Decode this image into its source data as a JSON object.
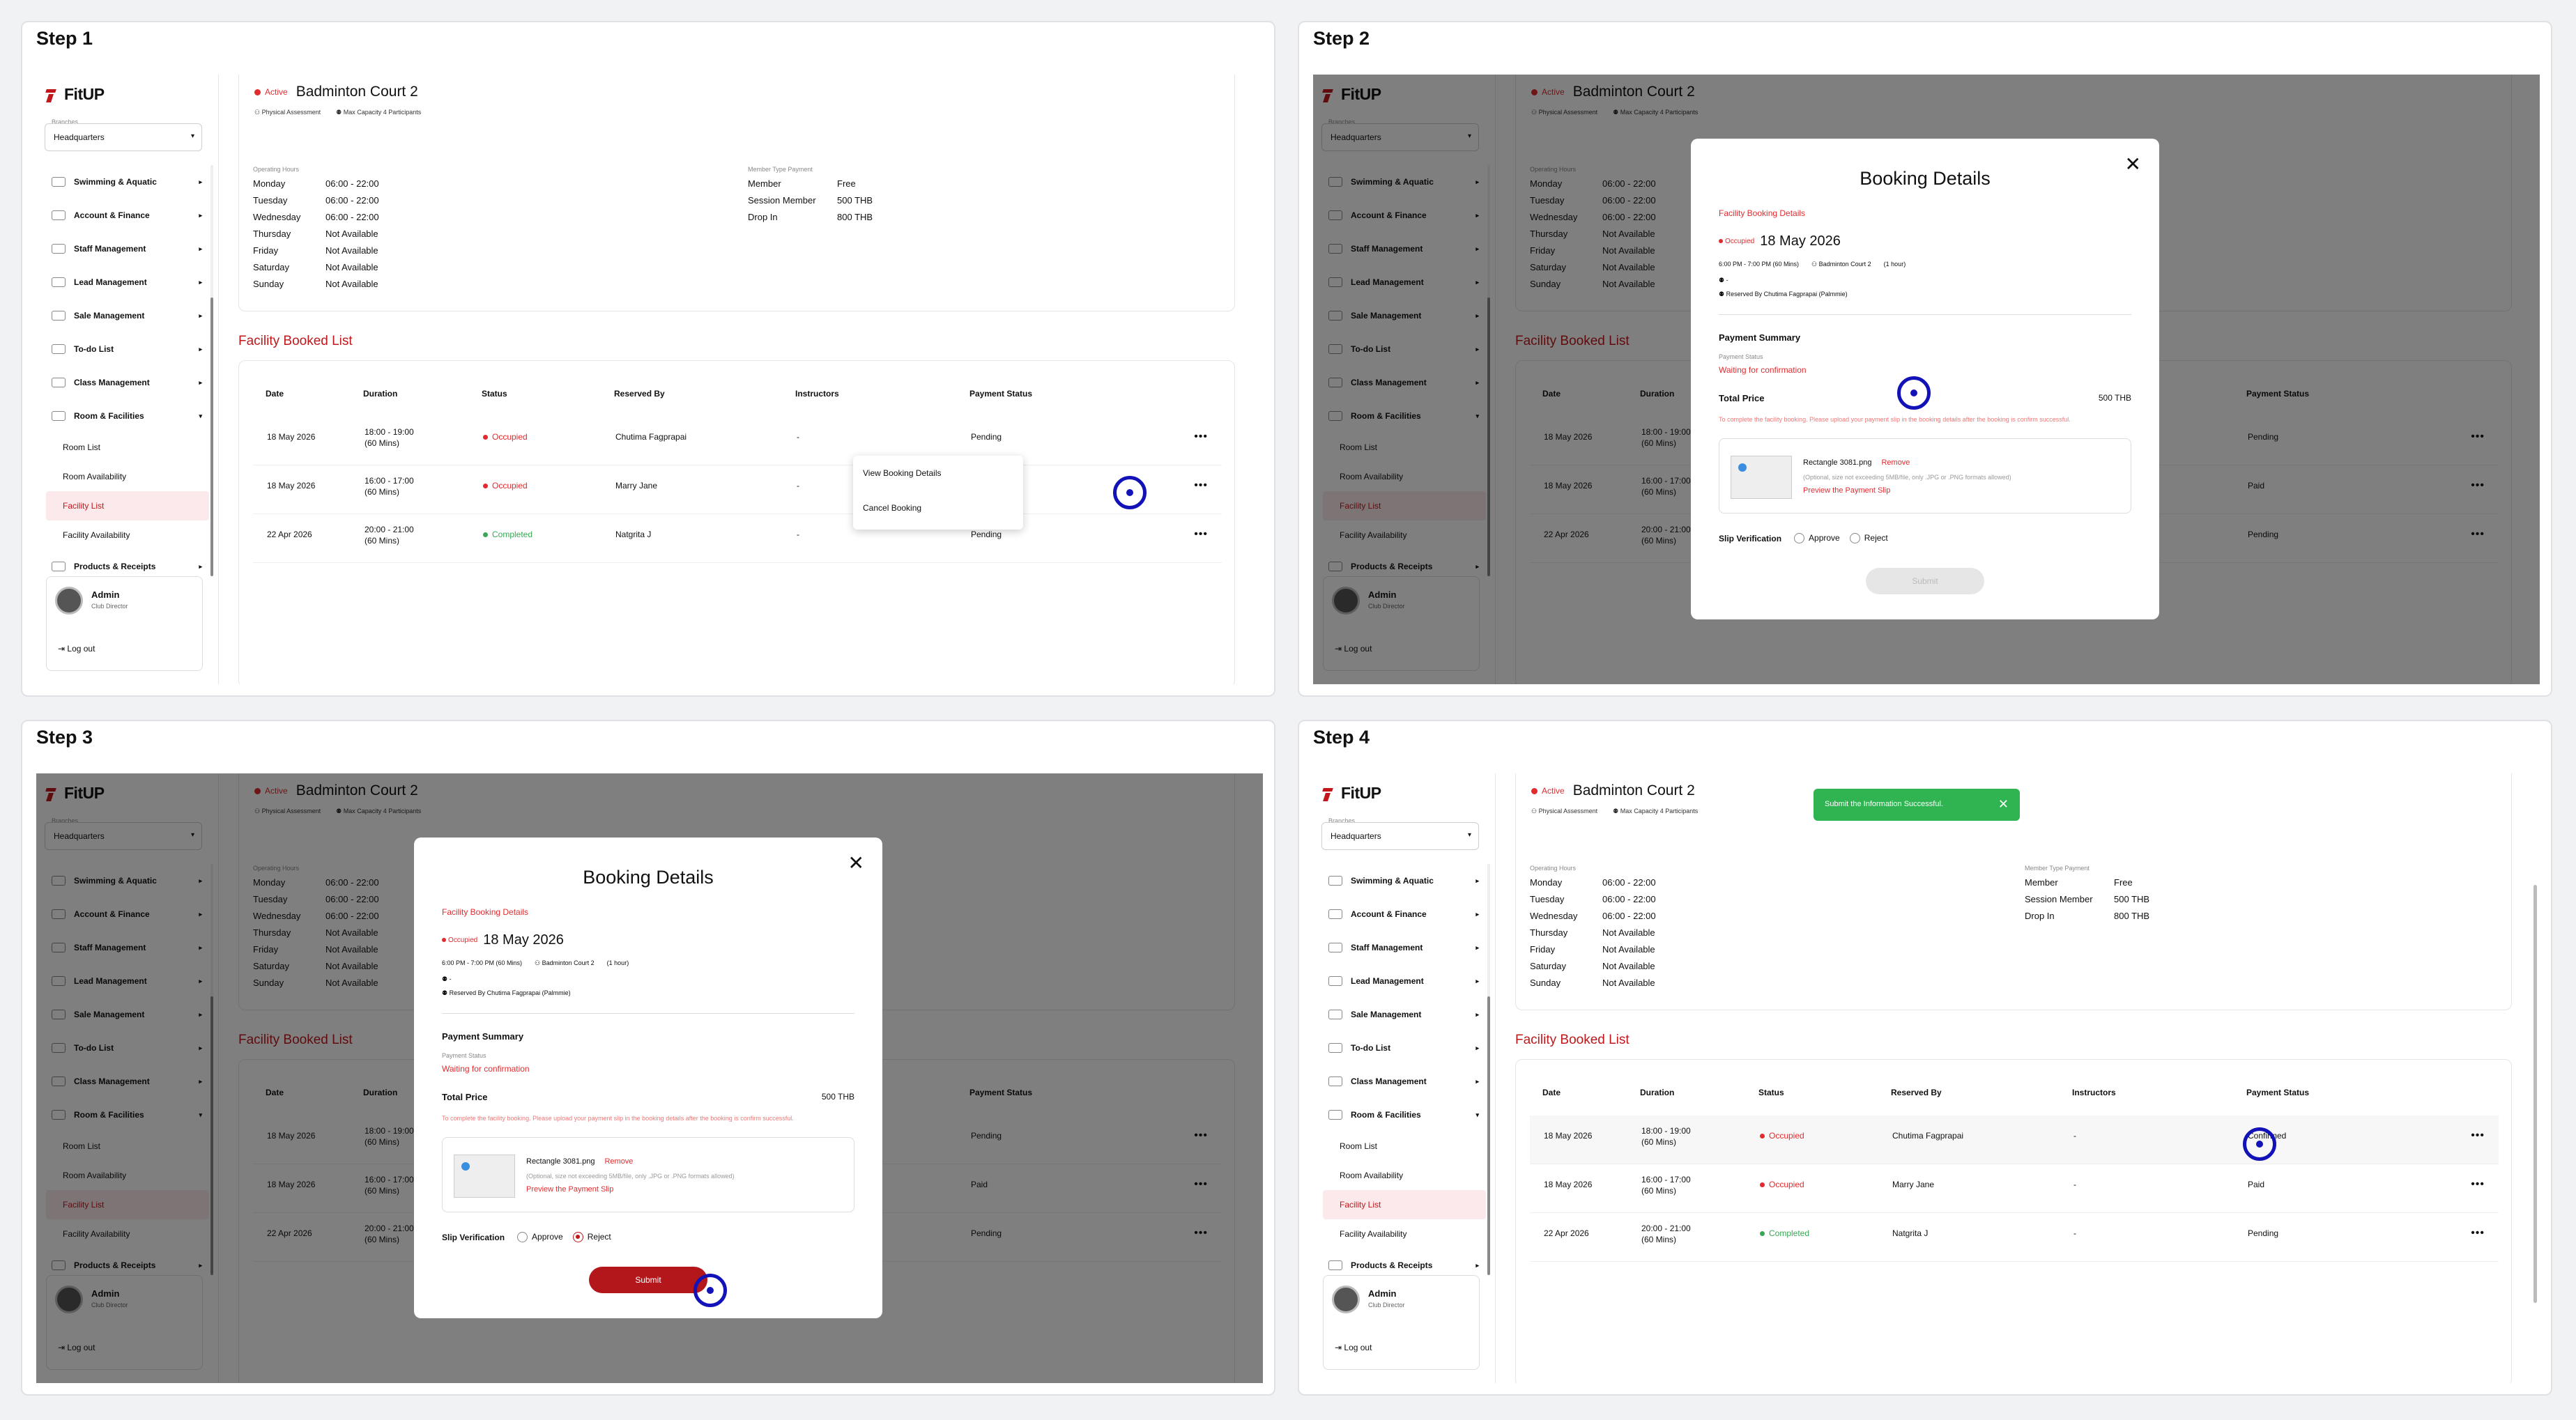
{
  "steps": [
    "Step 1",
    "Step 2",
    "Step 3",
    "Step 4"
  ],
  "app": {
    "logo": "FitUP",
    "branch_label": "Branches",
    "branch": "Headquarters",
    "nav": [
      {
        "label": "Swimming & Aquatic"
      },
      {
        "label": "Account & Finance"
      },
      {
        "label": "Staff Management"
      },
      {
        "label": "Lead Management"
      },
      {
        "label": "Sale Management"
      },
      {
        "label": "To-do List"
      },
      {
        "label": "Class Management"
      },
      {
        "label": "Room & Facilities"
      }
    ],
    "sub_nav": [
      "Room List",
      "Room Availability",
      "Facility List",
      "Facility Availability"
    ],
    "nav_last": "Products & Receipts",
    "user": {
      "name": "Admin",
      "role": "Club Director",
      "logout": "Log out"
    }
  },
  "facility": {
    "status": "Active",
    "name": "Badminton Court 2",
    "type": "Physical Assessment",
    "capacity": "Max Capacity 4 Participants",
    "hours_label": "Operating Hours",
    "hours": [
      {
        "day": "Monday",
        "time": "06:00 - 22:00"
      },
      {
        "day": "Tuesday",
        "time": "06:00 - 22:00"
      },
      {
        "day": "Wednesday",
        "time": "06:00 - 22:00"
      },
      {
        "day": "Thursday",
        "time": "Not Available"
      },
      {
        "day": "Friday",
        "time": "Not Available"
      },
      {
        "day": "Saturday",
        "time": "Not Available"
      },
      {
        "day": "Sunday",
        "time": "Not Available"
      }
    ],
    "member_label": "Member Type Payment",
    "member_types": [
      {
        "type": "Member",
        "price": "Free"
      },
      {
        "type": "Session Member",
        "price": "500 THB"
      },
      {
        "type": "Drop In",
        "price": "800 THB"
      }
    ]
  },
  "booked_list": {
    "title": "Facility Booked List",
    "headers": [
      "Date",
      "Duration",
      "Status",
      "Reserved By",
      "Instructors",
      "Payment Status"
    ],
    "rows": [
      {
        "date": "18 May 2026",
        "time": "18:00 - 19:00",
        "mins": "(60 Mins)",
        "status": "Occupied",
        "by": "Chutima Fagprapai",
        "instr": "-",
        "pay": "Pending",
        "pay_after": "Confirmed"
      },
      {
        "date": "18 May 2026",
        "time": "16:00 - 17:00",
        "mins": "(60 Mins)",
        "status": "Occupied",
        "by": "Marry Jane",
        "instr": "-",
        "pay": "Paid",
        "pay_after": "Paid"
      },
      {
        "date": "22 Apr 2026",
        "time": "20:00 - 21:00",
        "mins": "(60 Mins)",
        "status": "Completed",
        "by": "Natgrita J",
        "instr": "-",
        "pay": "Pending",
        "pay_after": "Pending"
      }
    ],
    "menu": [
      "View Booking Details",
      "Cancel Booking"
    ]
  },
  "modal": {
    "title": "Booking Details",
    "subtitle": "Facility Booking Details",
    "status": "Occupied",
    "date": "18 May 2026",
    "time": "6:00 PM - 7:00 PM (60 Mins)",
    "place": "Badminton Court 2",
    "duration": "(1 hour)",
    "dash": "-",
    "reserved": "Reserved By Chutima Fagprapai (Palmmie)",
    "pay_title": "Payment Summary",
    "pay_status_label": "Payment Status",
    "pay_status": "Waiting for confirmation",
    "total_label": "Total Price",
    "total": "500 THB",
    "note": "To complete the facility booking. Please upload your payment slip in the booking details after the booking is confirm successful.",
    "file": "Rectangle 3081.png",
    "remove": "Remove",
    "hint": "(Optional, size not exceeding 5MB/file, only .JPG or .PNG formats allowed)",
    "preview": "Preview the Payment Slip",
    "slip_label": "Slip Verification",
    "approve": "Approve",
    "reject": "Reject",
    "submit": "Submit"
  },
  "toast": {
    "text": "Submit the Information Successful."
  },
  "colors": {
    "brand": "#c0171b",
    "occupied": "#e12b2f",
    "completed": "#3aa756",
    "toast": "#2fb451",
    "cursor": "#1212b8"
  }
}
